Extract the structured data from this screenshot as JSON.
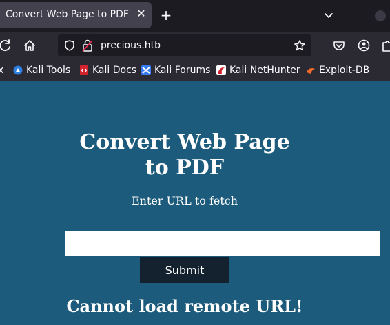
{
  "browser": {
    "tab": {
      "title": "Convert Web Page to PDF",
      "close_icon": "close-icon"
    },
    "new_tab_icon": "plus-icon",
    "tab_list_icon": "chevron-down-icon",
    "url": "precious.htb"
  },
  "bookmarks": [
    {
      "label": "Kali Tools",
      "icon": "kali-tools-icon"
    },
    {
      "label": "Kali Docs",
      "icon": "kali-docs-icon"
    },
    {
      "label": "Kali Forums",
      "icon": "kali-forums-icon"
    },
    {
      "label": "Kali NetHunter",
      "icon": "kali-nethunter-icon"
    },
    {
      "label": "Exploit-DB",
      "icon": "exploit-db-icon"
    }
  ],
  "page": {
    "heading": "Convert Web Page to PDF",
    "prompt": "Enter URL to fetch",
    "url_input_value": "",
    "submit_label": "Submit",
    "error_message": "Cannot load remote URL!"
  },
  "colors": {
    "page_background": "#1c5b7b",
    "submit_button": "#13222e",
    "chrome_dark": "#1c1b22",
    "chrome": "#2b2a33"
  }
}
